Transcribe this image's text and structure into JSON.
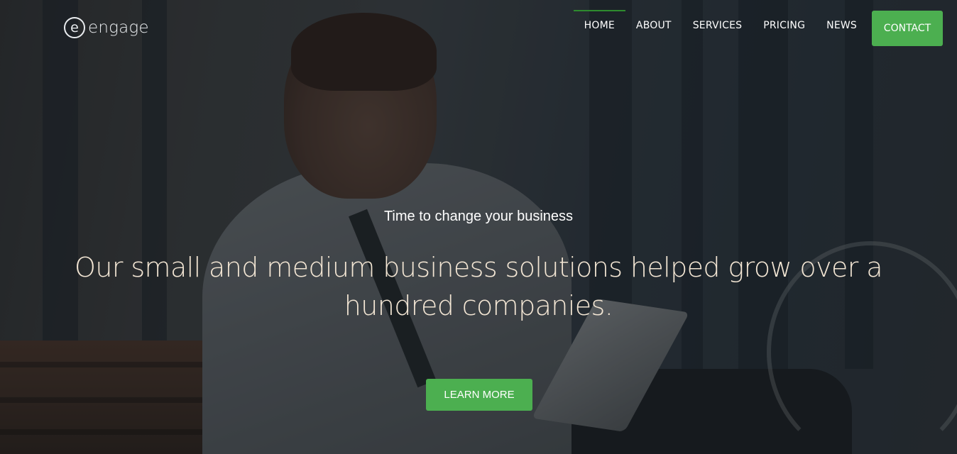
{
  "brand": {
    "logo_letter": "e",
    "name": "engage"
  },
  "nav": {
    "items": [
      {
        "label": "HOME",
        "active": true
      },
      {
        "label": "ABOUT",
        "active": false
      },
      {
        "label": "SERVICES",
        "active": false
      },
      {
        "label": "PRICING",
        "active": false
      },
      {
        "label": "NEWS",
        "active": false
      }
    ],
    "contact_label": "CONTACT"
  },
  "hero": {
    "tagline": "Time to change your business",
    "headline": "Our small and medium business solutions helped grow over a hundred companies.",
    "cta_label": "LEARN MORE"
  },
  "colors": {
    "accent": "#4caf50",
    "active_underline": "#2e8b2e",
    "headline_text": "#f3e6d4"
  },
  "icons": {
    "logo": "circle-e-logo-icon"
  }
}
